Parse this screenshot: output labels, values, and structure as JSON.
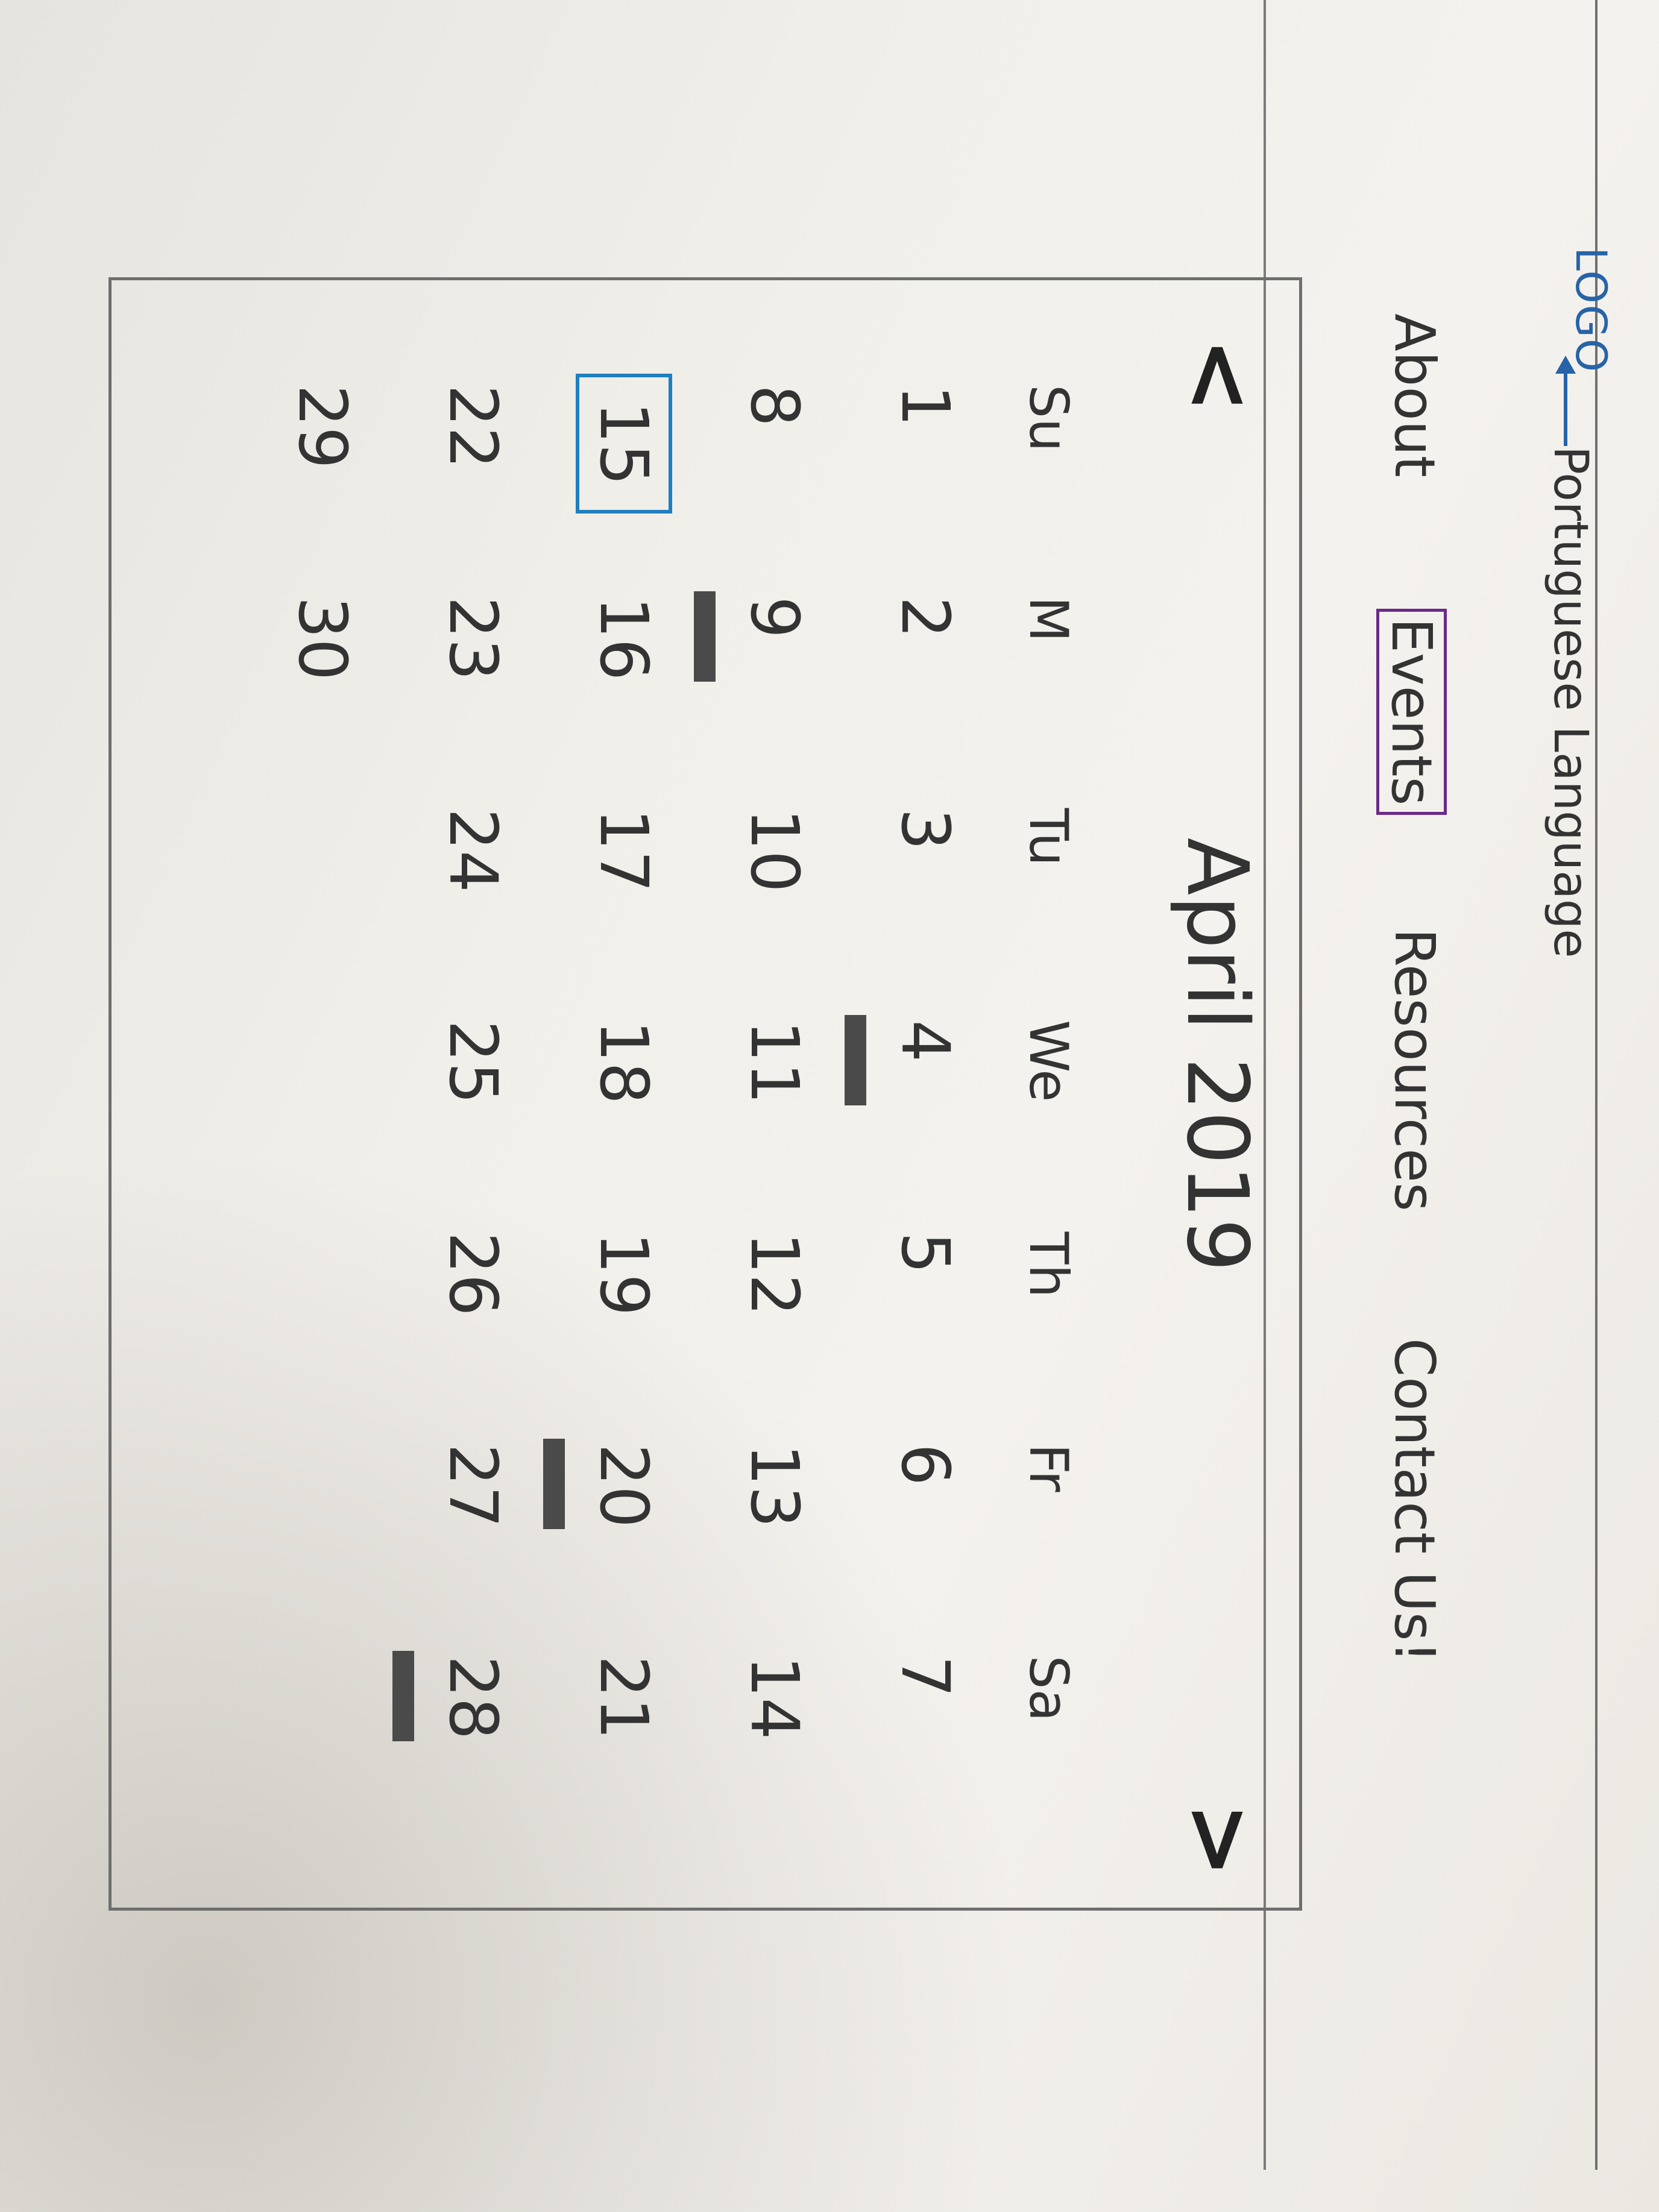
{
  "header": {
    "logo": "LOGO",
    "language_link": "Portuguese Language"
  },
  "nav": {
    "items": [
      "About",
      "Events",
      "Resources",
      "Contact Us!"
    ],
    "active": "Events"
  },
  "calendar": {
    "title": "April 2019",
    "prev": "<",
    "next": ">",
    "weekdays": [
      "Su",
      "M",
      "Tu",
      "We",
      "Th",
      "Fr",
      "Sa"
    ],
    "weeks": [
      [
        "1",
        "2",
        "3",
        "4",
        "5",
        "6",
        "7"
      ],
      [
        "8",
        "9",
        "10",
        "11",
        "12",
        "13",
        "14"
      ],
      [
        "15",
        "16",
        "17",
        "18",
        "19",
        "20",
        "21"
      ],
      [
        "22",
        "23",
        "24",
        "25",
        "26",
        "27",
        "28"
      ],
      [
        "29",
        "30",
        "",
        "",
        "",
        "",
        ""
      ]
    ],
    "today": "15",
    "event_days": [
      "4",
      "9",
      "20",
      "28"
    ],
    "colors": {
      "today_box": "#1f7fc0",
      "events_box": "#6a2a8a",
      "event_marker": "#4a4a4a",
      "logo": "#2763a8"
    }
  }
}
